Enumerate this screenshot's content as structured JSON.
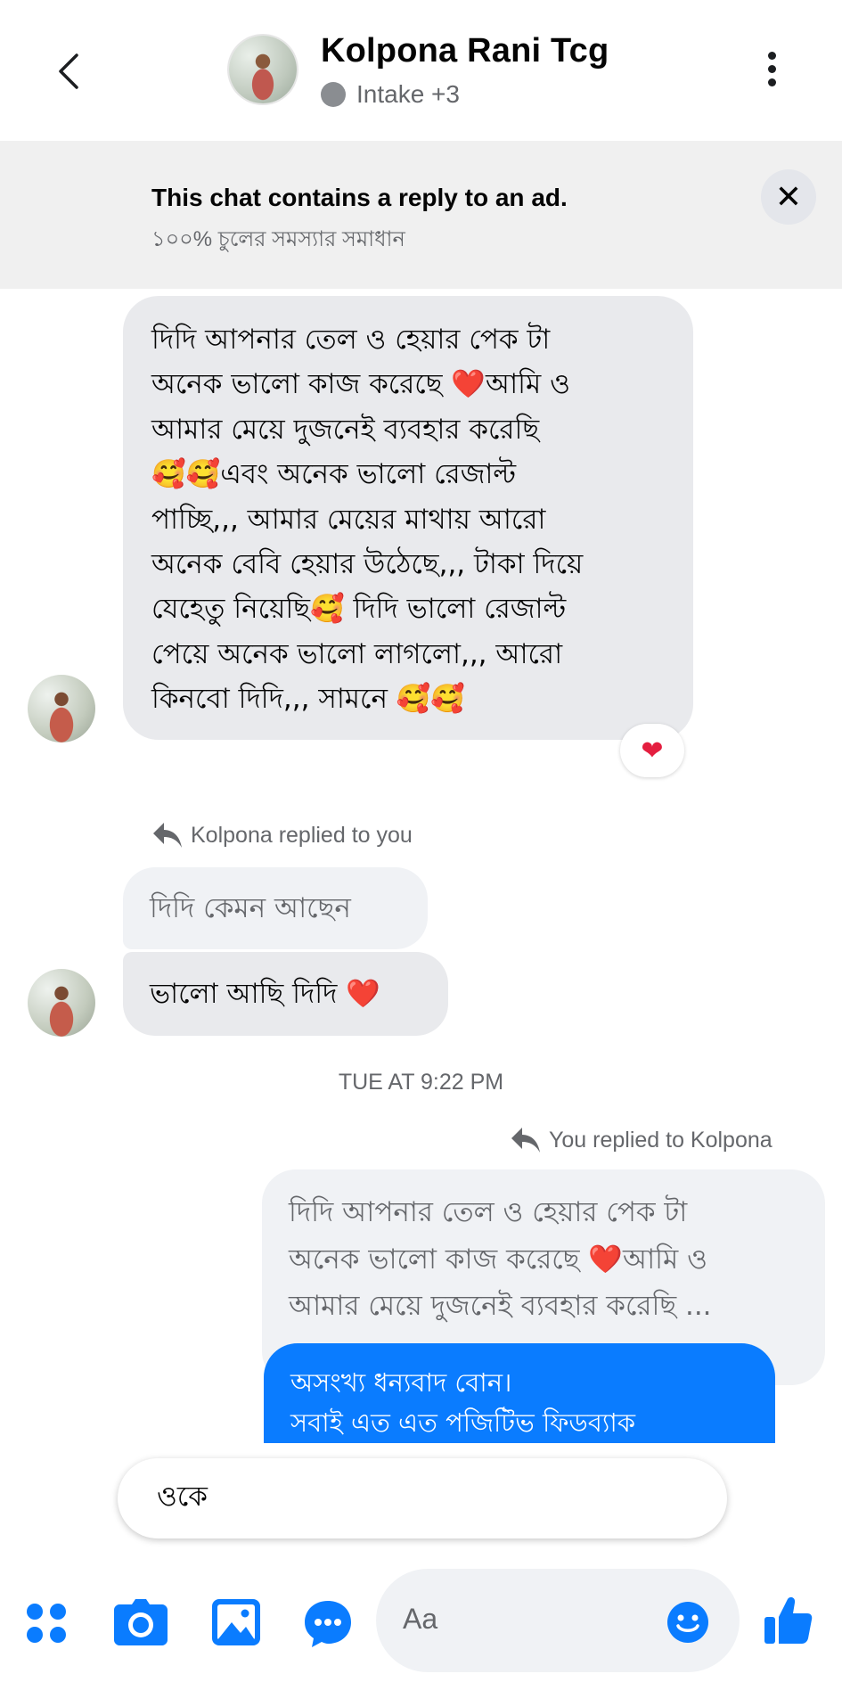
{
  "header": {
    "contact_name": "Kolpona Rani Tcg",
    "status_text": "Intake +3"
  },
  "ad_banner": {
    "title": "This chat contains a reply to an ad.",
    "subtitle": "১০০% চুলের সমস্যার সমাধান",
    "close_label": "✕"
  },
  "messages": {
    "incoming_1": {
      "lines": [
        "দিদি আপনার তেল ও হেয়ার পেক টা",
        "অনেক ভালো কাজ করেছে ❤️আমি ও",
        "আমার মেয়ে দুজনেই ব্যবহার করেছি",
        "🥰🥰এবং অনেক ভালো রেজাল্ট",
        "পাচ্ছি,,, আমার মেয়ের মাথায় আরো",
        "অনেক বেবি হেয়ার উঠেছে,,, টাকা দিয়ে",
        "যেহেতু নিয়েছি🥰 দিদি ভালো রেজাল্ট",
        "পেয়ে অনেক ভালো লাগলো,,, আরো",
        "কিনবো দিদি,,, সামনে 🥰🥰"
      ],
      "reaction": "❤"
    },
    "reply_label_in": "Kolpona replied to you",
    "quoted_in": "দিদি কেমন আছেন",
    "incoming_2": "ভালো আছি দিদি ❤️",
    "timestamp": "TUE AT 9:22 PM",
    "reply_label_out": "You replied to Kolpona",
    "quoted_out": {
      "lines": [
        "দিদি আপনার তেল ও হেয়ার পেক টা",
        "অনেক ভালো কাজ করেছে ❤️আমি ও",
        "আমার মেয়ে দুজনেই ব্যবহার করেছি ..."
      ]
    },
    "outgoing_1": {
      "lines": [
        "অসংখ্য ধন্যবাদ বোন।",
        "সবাই এত এত পজিটিভ ফিডব্যাক"
      ]
    }
  },
  "quick_reply": {
    "text": "ওকে"
  },
  "composer": {
    "placeholder": "Aa"
  },
  "colors": {
    "accent": "#0a7cff",
    "incoming_bubble": "#e9eaed",
    "banner_bg": "#f0f0f0",
    "reaction_heart": "#e41e3f"
  },
  "icons": {
    "back": "chevron-left-icon",
    "more": "kebab-icon",
    "close": "close-icon",
    "reply": "reply-arrow-icon",
    "apps": "apps-grid-icon",
    "camera": "camera-icon",
    "gallery": "image-icon",
    "chat": "chat-bubble-icon",
    "emoji": "emoji-icon",
    "like": "thumbs-up-icon"
  }
}
